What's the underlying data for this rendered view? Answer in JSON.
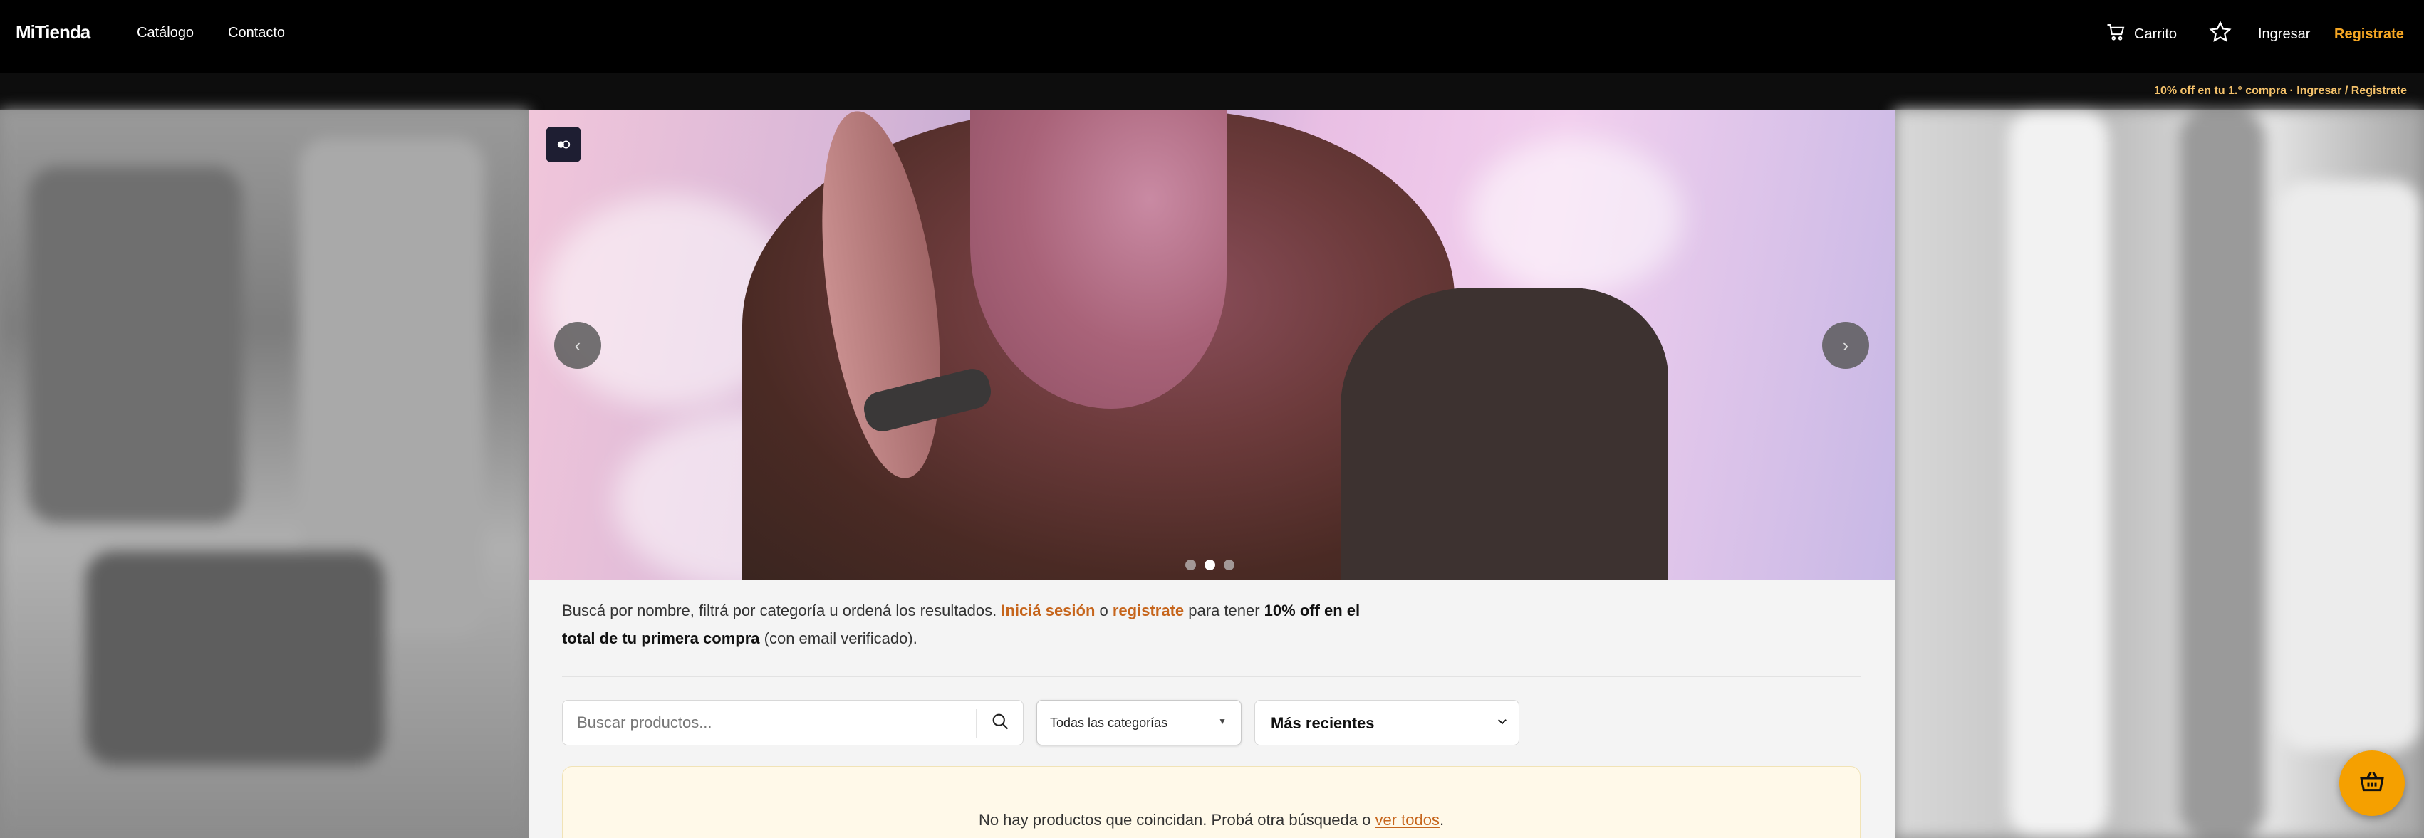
{
  "brand": {
    "logo": "MiTienda"
  },
  "nav": {
    "catalogo": "Catálogo",
    "contacto": "Contacto",
    "carrito": "Carrito",
    "ingresar": "Ingresar",
    "registrate": "Registrate"
  },
  "promo": {
    "text_prefix": "10% off en tu 1.° compra · ",
    "ingresar": "Ingresar",
    "separator": " / ",
    "registrate": "Registrate"
  },
  "hero": {
    "prev_symbol": "‹",
    "next_symbol": "›",
    "slides_count": 3,
    "active_slide": 2
  },
  "intro": {
    "part1": "Buscá por nombre, filtrá por categoría u ordená los resultados. ",
    "login_link": "Iniciá sesión",
    "part2": " o ",
    "register_link": "registrate",
    "part3": " para tener ",
    "bold": "10% off en el total de tu primera compra",
    "part4": " (con email verificado)."
  },
  "search": {
    "placeholder": "Buscar productos..."
  },
  "category": {
    "selected": "Todas las categorías"
  },
  "sort": {
    "selected": "Más recientes"
  },
  "empty": {
    "message": "No hay productos que coincidan. Probá otra búsqueda o ",
    "link": "ver todos",
    "end": "."
  },
  "colors": {
    "accent": "#f5a623",
    "link": "#c6651c",
    "fab": "#f5a000"
  },
  "icons": [
    "cart-icon",
    "star-icon",
    "search-icon",
    "chevron-down-icon",
    "basket-icon",
    "accessibility-icon"
  ]
}
